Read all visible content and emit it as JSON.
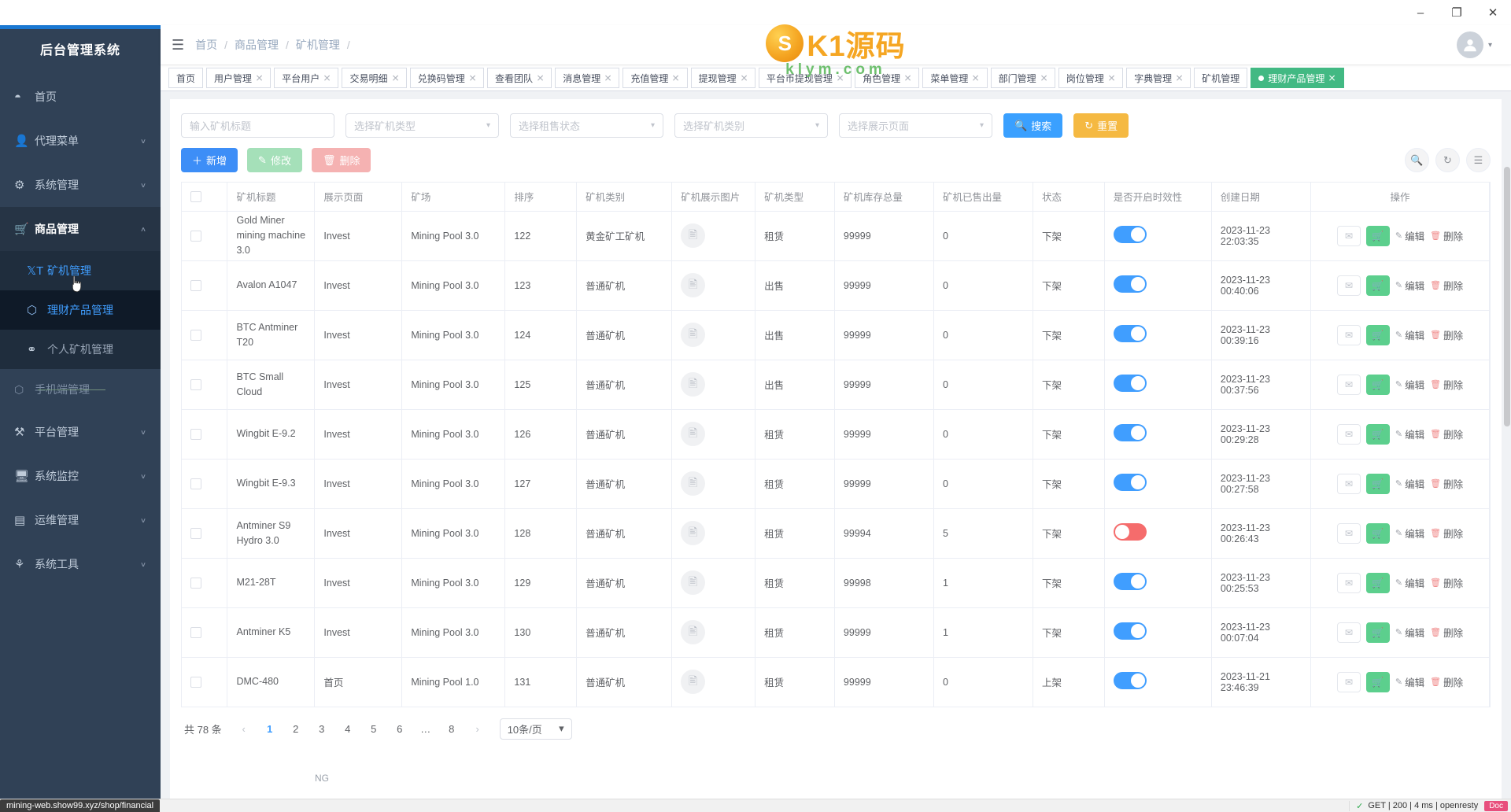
{
  "window": {
    "minimize": "–",
    "maximize": "❐",
    "close": "✕"
  },
  "sidebar": {
    "title": "后台管理系统",
    "items": [
      {
        "label": "首页",
        "icon": "dashboard-icon",
        "glyph": "◔",
        "arrow": ""
      },
      {
        "label": "代理菜单",
        "icon": "agent-icon",
        "glyph": "♟",
        "arrow": "∨"
      },
      {
        "label": "系统管理",
        "icon": "gear-icon",
        "glyph": "⚙",
        "arrow": "∨"
      },
      {
        "label": "商品管理",
        "icon": "cart-icon",
        "glyph": "Ὥ2",
        "arrow": "∧"
      }
    ],
    "submenu": [
      {
        "label": "矿机管理",
        "icon": "text-size-icon",
        "glyph": "T"
      },
      {
        "label": "理财产品管理",
        "icon": "cube-icon",
        "glyph": "⬡"
      },
      {
        "label": "个人矿机管理",
        "icon": "people-icon",
        "glyph": "⚬"
      }
    ],
    "ghost_item": {
      "label": "手机端管理",
      "icon": "mobile-icon",
      "glyph": "⬡"
    },
    "items_lower": [
      {
        "label": "平台管理",
        "icon": "tools-icon",
        "glyph": "⚒",
        "arrow": "∨"
      },
      {
        "label": "系统监控",
        "icon": "monitor-icon",
        "glyph": "⌨",
        "arrow": "∨"
      },
      {
        "label": "运维管理",
        "icon": "server-icon",
        "glyph": "▤",
        "arrow": "∨"
      },
      {
        "label": "系统工具",
        "icon": "wrench-icon",
        "glyph": "⑂",
        "arrow": "∨"
      }
    ]
  },
  "navbar": {
    "hamburger": "☰",
    "breadcrumb": [
      "首页",
      "商品管理",
      "矿机管理"
    ],
    "separator": "/",
    "avatar_glyph": "●",
    "caret": "▾"
  },
  "watermark": {
    "ball_letter": "S",
    "text": "K1源码",
    "sub": "klym.com"
  },
  "tabs": [
    {
      "label": "首页",
      "closable": false,
      "active": false
    },
    {
      "label": "用户管理",
      "closable": true,
      "active": false
    },
    {
      "label": "平台用户",
      "closable": true,
      "active": false
    },
    {
      "label": "交易明细",
      "closable": true,
      "active": false
    },
    {
      "label": "兑换码管理",
      "closable": true,
      "active": false
    },
    {
      "label": "查看团队",
      "closable": true,
      "active": false
    },
    {
      "label": "消息管理",
      "closable": true,
      "active": false
    },
    {
      "label": "充值管理",
      "closable": true,
      "active": false
    },
    {
      "label": "提现管理",
      "closable": true,
      "active": false
    },
    {
      "label": "平台币提现管理",
      "closable": true,
      "active": false
    },
    {
      "label": "角色管理",
      "closable": true,
      "active": false
    },
    {
      "label": "菜单管理",
      "closable": true,
      "active": false
    },
    {
      "label": "部门管理",
      "closable": true,
      "active": false
    },
    {
      "label": "岗位管理",
      "closable": true,
      "active": false
    },
    {
      "label": "字典管理",
      "closable": true,
      "active": false
    },
    {
      "label": "矿机管理",
      "closable": false,
      "active": false
    },
    {
      "label": "理财产品管理",
      "closable": true,
      "active": true
    }
  ],
  "filters": {
    "title_placeholder": "输入矿机标题",
    "type_placeholder": "选择矿机类型",
    "rent_placeholder": "选择租售状态",
    "category_placeholder": "选择矿机类别",
    "page_placeholder": "选择展示页面",
    "search_label": "搜索",
    "search_icon": "🔍",
    "reset_label": "重置",
    "reset_icon": "↻"
  },
  "actions": {
    "add_label": "新增",
    "add_icon": "＋",
    "edit_label": "修改",
    "edit_icon": "✎",
    "delete_label": "删除",
    "delete_icon": "🗑",
    "tool_search": "🔍",
    "tool_refresh": "↻",
    "tool_columns": "≣"
  },
  "table": {
    "columns": [
      "",
      "矿机标题",
      "展示页面",
      "矿场",
      "排序",
      "矿机类别",
      "矿机展示图片",
      "矿机类型",
      "矿机库存总量",
      "矿机已售出量",
      "状态",
      "是否开启时效性",
      "创建日期",
      "操作"
    ],
    "image_glyph": "☷",
    "rows": [
      {
        "title": "Gold Miner mining machine 3.0",
        "page": "Invest",
        "pool": "Mining Pool 3.0",
        "sort": "122",
        "category": "黄金矿工矿机",
        "type": "租赁",
        "stock": "99999",
        "sold": "0",
        "status": "下架",
        "toggle": "on",
        "created": "2023-11-23 22:03:35"
      },
      {
        "title": "Avalon A1047",
        "page": "Invest",
        "pool": "Mining Pool 3.0",
        "sort": "123",
        "category": "普通矿机",
        "type": "出售",
        "stock": "99999",
        "sold": "0",
        "status": "下架",
        "toggle": "on",
        "created": "2023-11-23 00:40:06"
      },
      {
        "title": "BTC Antminer T20",
        "page": "Invest",
        "pool": "Mining Pool 3.0",
        "sort": "124",
        "category": "普通矿机",
        "type": "出售",
        "stock": "99999",
        "sold": "0",
        "status": "下架",
        "toggle": "on",
        "created": "2023-11-23 00:39:16"
      },
      {
        "title": "BTC Small Cloud",
        "page": "Invest",
        "pool": "Mining Pool 3.0",
        "sort": "125",
        "category": "普通矿机",
        "type": "出售",
        "stock": "99999",
        "sold": "0",
        "status": "下架",
        "toggle": "on",
        "created": "2023-11-23 00:37:56"
      },
      {
        "title": "Wingbit E-9.2",
        "page": "Invest",
        "pool": "Mining Pool 3.0",
        "sort": "126",
        "category": "普通矿机",
        "type": "租赁",
        "stock": "99999",
        "sold": "0",
        "status": "下架",
        "toggle": "on",
        "created": "2023-11-23 00:29:28"
      },
      {
        "title": "Wingbit E-9.3",
        "page": "Invest",
        "pool": "Mining Pool 3.0",
        "sort": "127",
        "category": "普通矿机",
        "type": "租赁",
        "stock": "99999",
        "sold": "0",
        "status": "下架",
        "toggle": "on",
        "created": "2023-11-23 00:27:58"
      },
      {
        "title": "Antminer S9 Hydro 3.0",
        "page": "Invest",
        "pool": "Mining Pool 3.0",
        "sort": "128",
        "category": "普通矿机",
        "type": "租赁",
        "stock": "99994",
        "sold": "5",
        "status": "下架",
        "toggle": "off",
        "created": "2023-11-23 00:26:43"
      },
      {
        "title": "M21-28T",
        "page": "Invest",
        "pool": "Mining Pool 3.0",
        "sort": "129",
        "category": "普通矿机",
        "type": "租赁",
        "stock": "99998",
        "sold": "1",
        "status": "下架",
        "toggle": "on",
        "created": "2023-11-23 00:25:53"
      },
      {
        "title": "Antminer K5",
        "page": "Invest",
        "pool": "Mining Pool 3.0",
        "sort": "130",
        "category": "普通矿机",
        "type": "租赁",
        "stock": "99999",
        "sold": "1",
        "status": "下架",
        "toggle": "on",
        "created": "2023-11-23 00:07:04"
      },
      {
        "title": "DMC-480",
        "page": "首页",
        "pool": "Mining Pool 1.0",
        "sort": "131",
        "category": "普通矿机",
        "type": "租赁",
        "stock": "99999",
        "sold": "0",
        "status": "上架",
        "toggle": "on",
        "created": "2023-11-21 23:46:39"
      }
    ],
    "row_ops": {
      "mail_icon": "✉",
      "cart_icon": "🛒",
      "edit_label": "编辑",
      "edit_icon": "✎",
      "delete_label": "删除",
      "delete_icon": "🗑"
    }
  },
  "pagination": {
    "total_text": "共 78 条",
    "prev": "‹",
    "next": "›",
    "pages": [
      "1",
      "2",
      "3",
      "4",
      "5",
      "6",
      "…",
      "8"
    ],
    "active_page": "1",
    "page_size": "10条/页",
    "chev": "∨"
  },
  "status": {
    "url": "mining-web.show99.xyz/shop/financial",
    "ghost_text": "NG",
    "devtools_method": "GET | 200 | 4 ms | openresty",
    "check": "✓",
    "doc": "Doc"
  }
}
